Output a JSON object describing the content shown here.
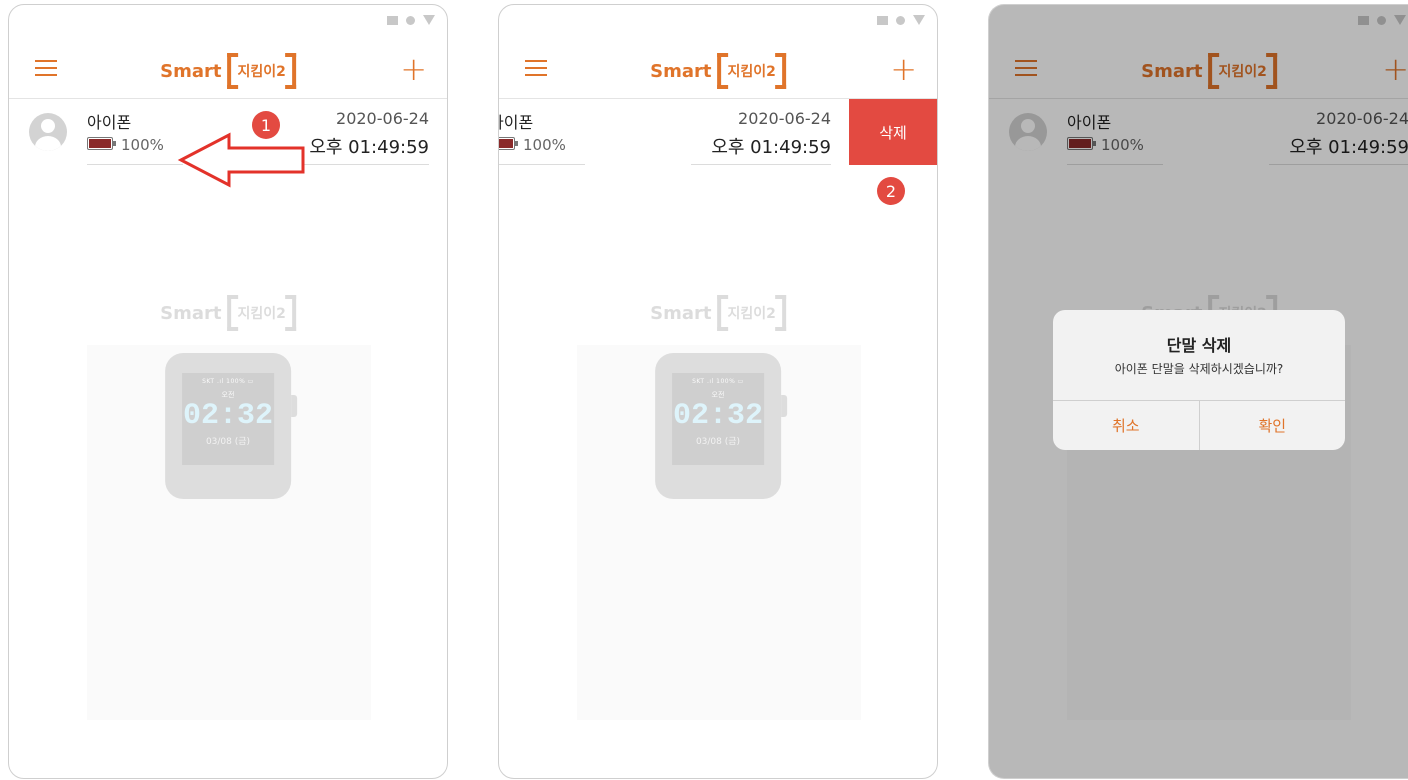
{
  "app": {
    "logo_prefix": "Smart",
    "logo_name": "지킴이2"
  },
  "device": {
    "name": "아이폰",
    "battery_percent": "100%",
    "date": "2020-06-24",
    "time": "오후 01:49:59"
  },
  "swipe": {
    "delete_label": "삭제"
  },
  "steps": {
    "step1": "1",
    "step2": "2"
  },
  "watch": {
    "carrier_status": "SKT  .ıl 100% ▭",
    "ampm": "오전",
    "time": "02:32",
    "date": "03/08 (금)"
  },
  "dialog": {
    "title": "단말 삭제",
    "message": "아이폰 단말을 삭제하시겠습니까?",
    "cancel_label": "취소",
    "confirm_label": "확인"
  },
  "colors": {
    "accent": "#e0742a",
    "danger": "#e34a41"
  }
}
